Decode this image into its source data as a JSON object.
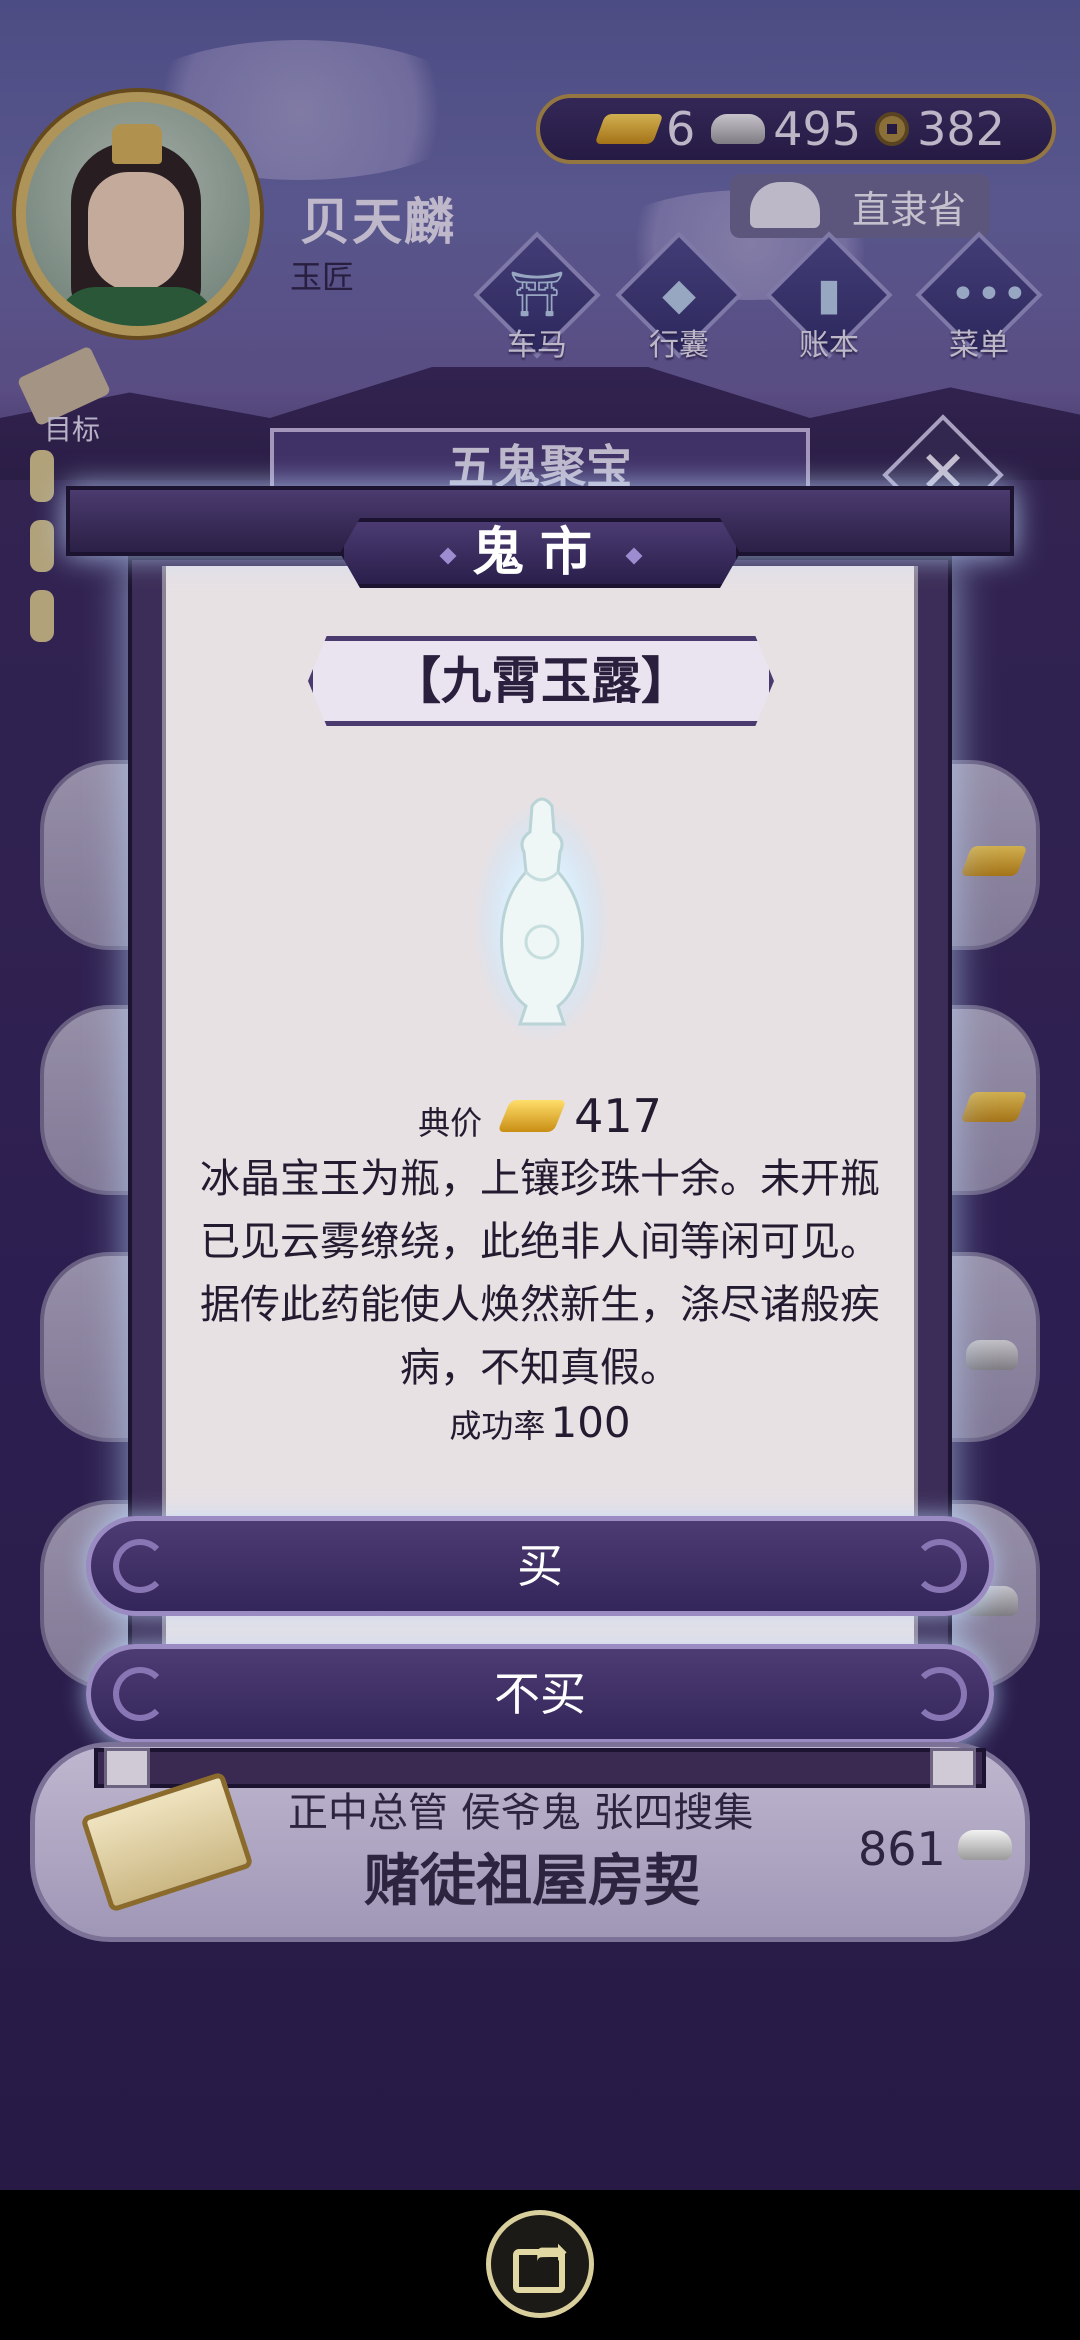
{
  "hud": {
    "player_name": "贝天麟",
    "player_title": "玉匠",
    "currency": {
      "gold": "6",
      "silver": "495",
      "coins": "382"
    },
    "location": "直隶省",
    "nav": [
      {
        "label": "车马",
        "icon": "carriage-icon"
      },
      {
        "label": "行囊",
        "icon": "bag-icon"
      },
      {
        "label": "账本",
        "icon": "ledger-icon"
      },
      {
        "label": "菜单",
        "icon": "menu-dots-icon"
      }
    ],
    "goal_label": "目标",
    "shop_banner": "五鬼聚宝",
    "close": "✕"
  },
  "modal": {
    "title": "鬼市",
    "item_name": "【九霄玉露】",
    "price_label": "典价",
    "price_value": "417",
    "description": "冰晶宝玉为瓶，上镶珍珠十余。未开瓶已见云雾缭绕，此绝非人间等闲可见。据传此药能使人焕然新生，涤尽诸般疾病，不知真假。",
    "success_label": "成功率",
    "success_value": "100",
    "buy_label": "买",
    "decline_label": "不买"
  },
  "list_item": {
    "subtitle": "正中总管 侯爷鬼 张四搜集",
    "title": "赌徒祖屋房契",
    "price": "861"
  },
  "system": {
    "share_icon": "share-icon"
  },
  "colors": {
    "accent_purple": "#3b2d57",
    "paper": "#e7e1e4",
    "gold": "#d8b357",
    "glow": "#bedcff"
  }
}
